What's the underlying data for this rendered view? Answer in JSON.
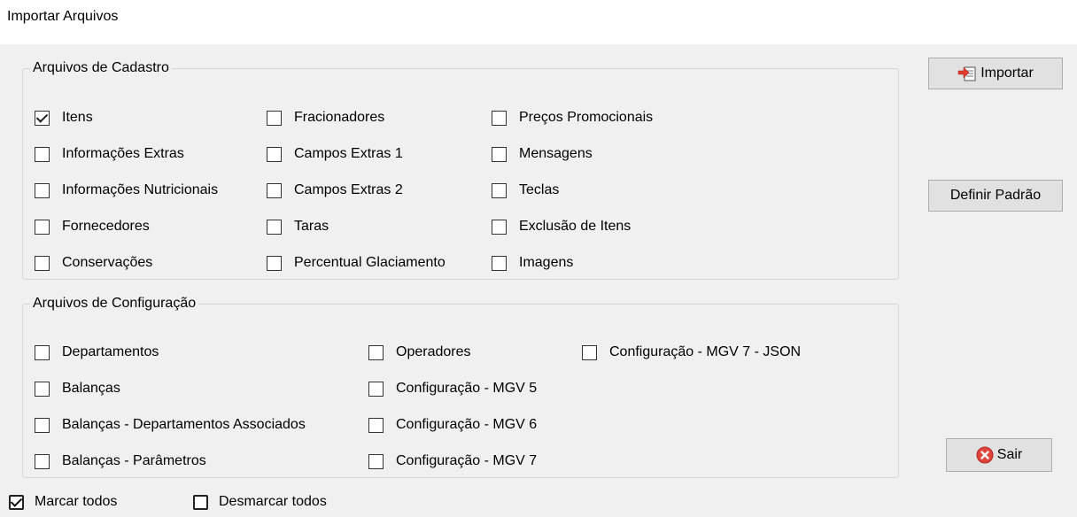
{
  "window": {
    "title": "Importar Arquivos"
  },
  "cadastro": {
    "legend": "Arquivos de Cadastro",
    "items": [
      {
        "label": "Itens",
        "checked": true
      },
      {
        "label": "Informações Extras",
        "checked": false
      },
      {
        "label": "Informações Nutricionais",
        "checked": false
      },
      {
        "label": "Fornecedores",
        "checked": false
      },
      {
        "label": "Conservações",
        "checked": false
      },
      {
        "label": "Fracionadores",
        "checked": false
      },
      {
        "label": "Campos Extras 1",
        "checked": false
      },
      {
        "label": "Campos Extras 2",
        "checked": false
      },
      {
        "label": "Taras",
        "checked": false
      },
      {
        "label": "Percentual Glaciamento",
        "checked": false
      },
      {
        "label": "Preços Promocionais",
        "checked": false
      },
      {
        "label": "Mensagens",
        "checked": false
      },
      {
        "label": "Teclas",
        "checked": false
      },
      {
        "label": "Exclusão de Itens",
        "checked": false
      },
      {
        "label": "Imagens",
        "checked": false
      }
    ]
  },
  "configuracao": {
    "legend": "Arquivos de Configuração",
    "items": [
      {
        "label": "Departamentos",
        "checked": false
      },
      {
        "label": "Balanças",
        "checked": false
      },
      {
        "label": "Balanças - Departamentos Associados",
        "checked": false
      },
      {
        "label": "Balanças - Parâmetros",
        "checked": false
      },
      {
        "label": "Operadores",
        "checked": false
      },
      {
        "label": "Configuração - MGV 5",
        "checked": false
      },
      {
        "label": "Configuração - MGV 6",
        "checked": false
      },
      {
        "label": "Configuração - MGV 7",
        "checked": false
      },
      {
        "label": "Configuração - MGV 7 - JSON",
        "checked": false
      }
    ]
  },
  "buttons": {
    "importar": "Importar",
    "definir_padrao": "Definir Padrão",
    "sair": "Sair",
    "importar_icon": "import-file-icon",
    "sair_icon": "close-circle-icon"
  },
  "footer": {
    "marcar_todos": "Marcar todos",
    "desmarcar_todos": "Desmarcar todos"
  }
}
